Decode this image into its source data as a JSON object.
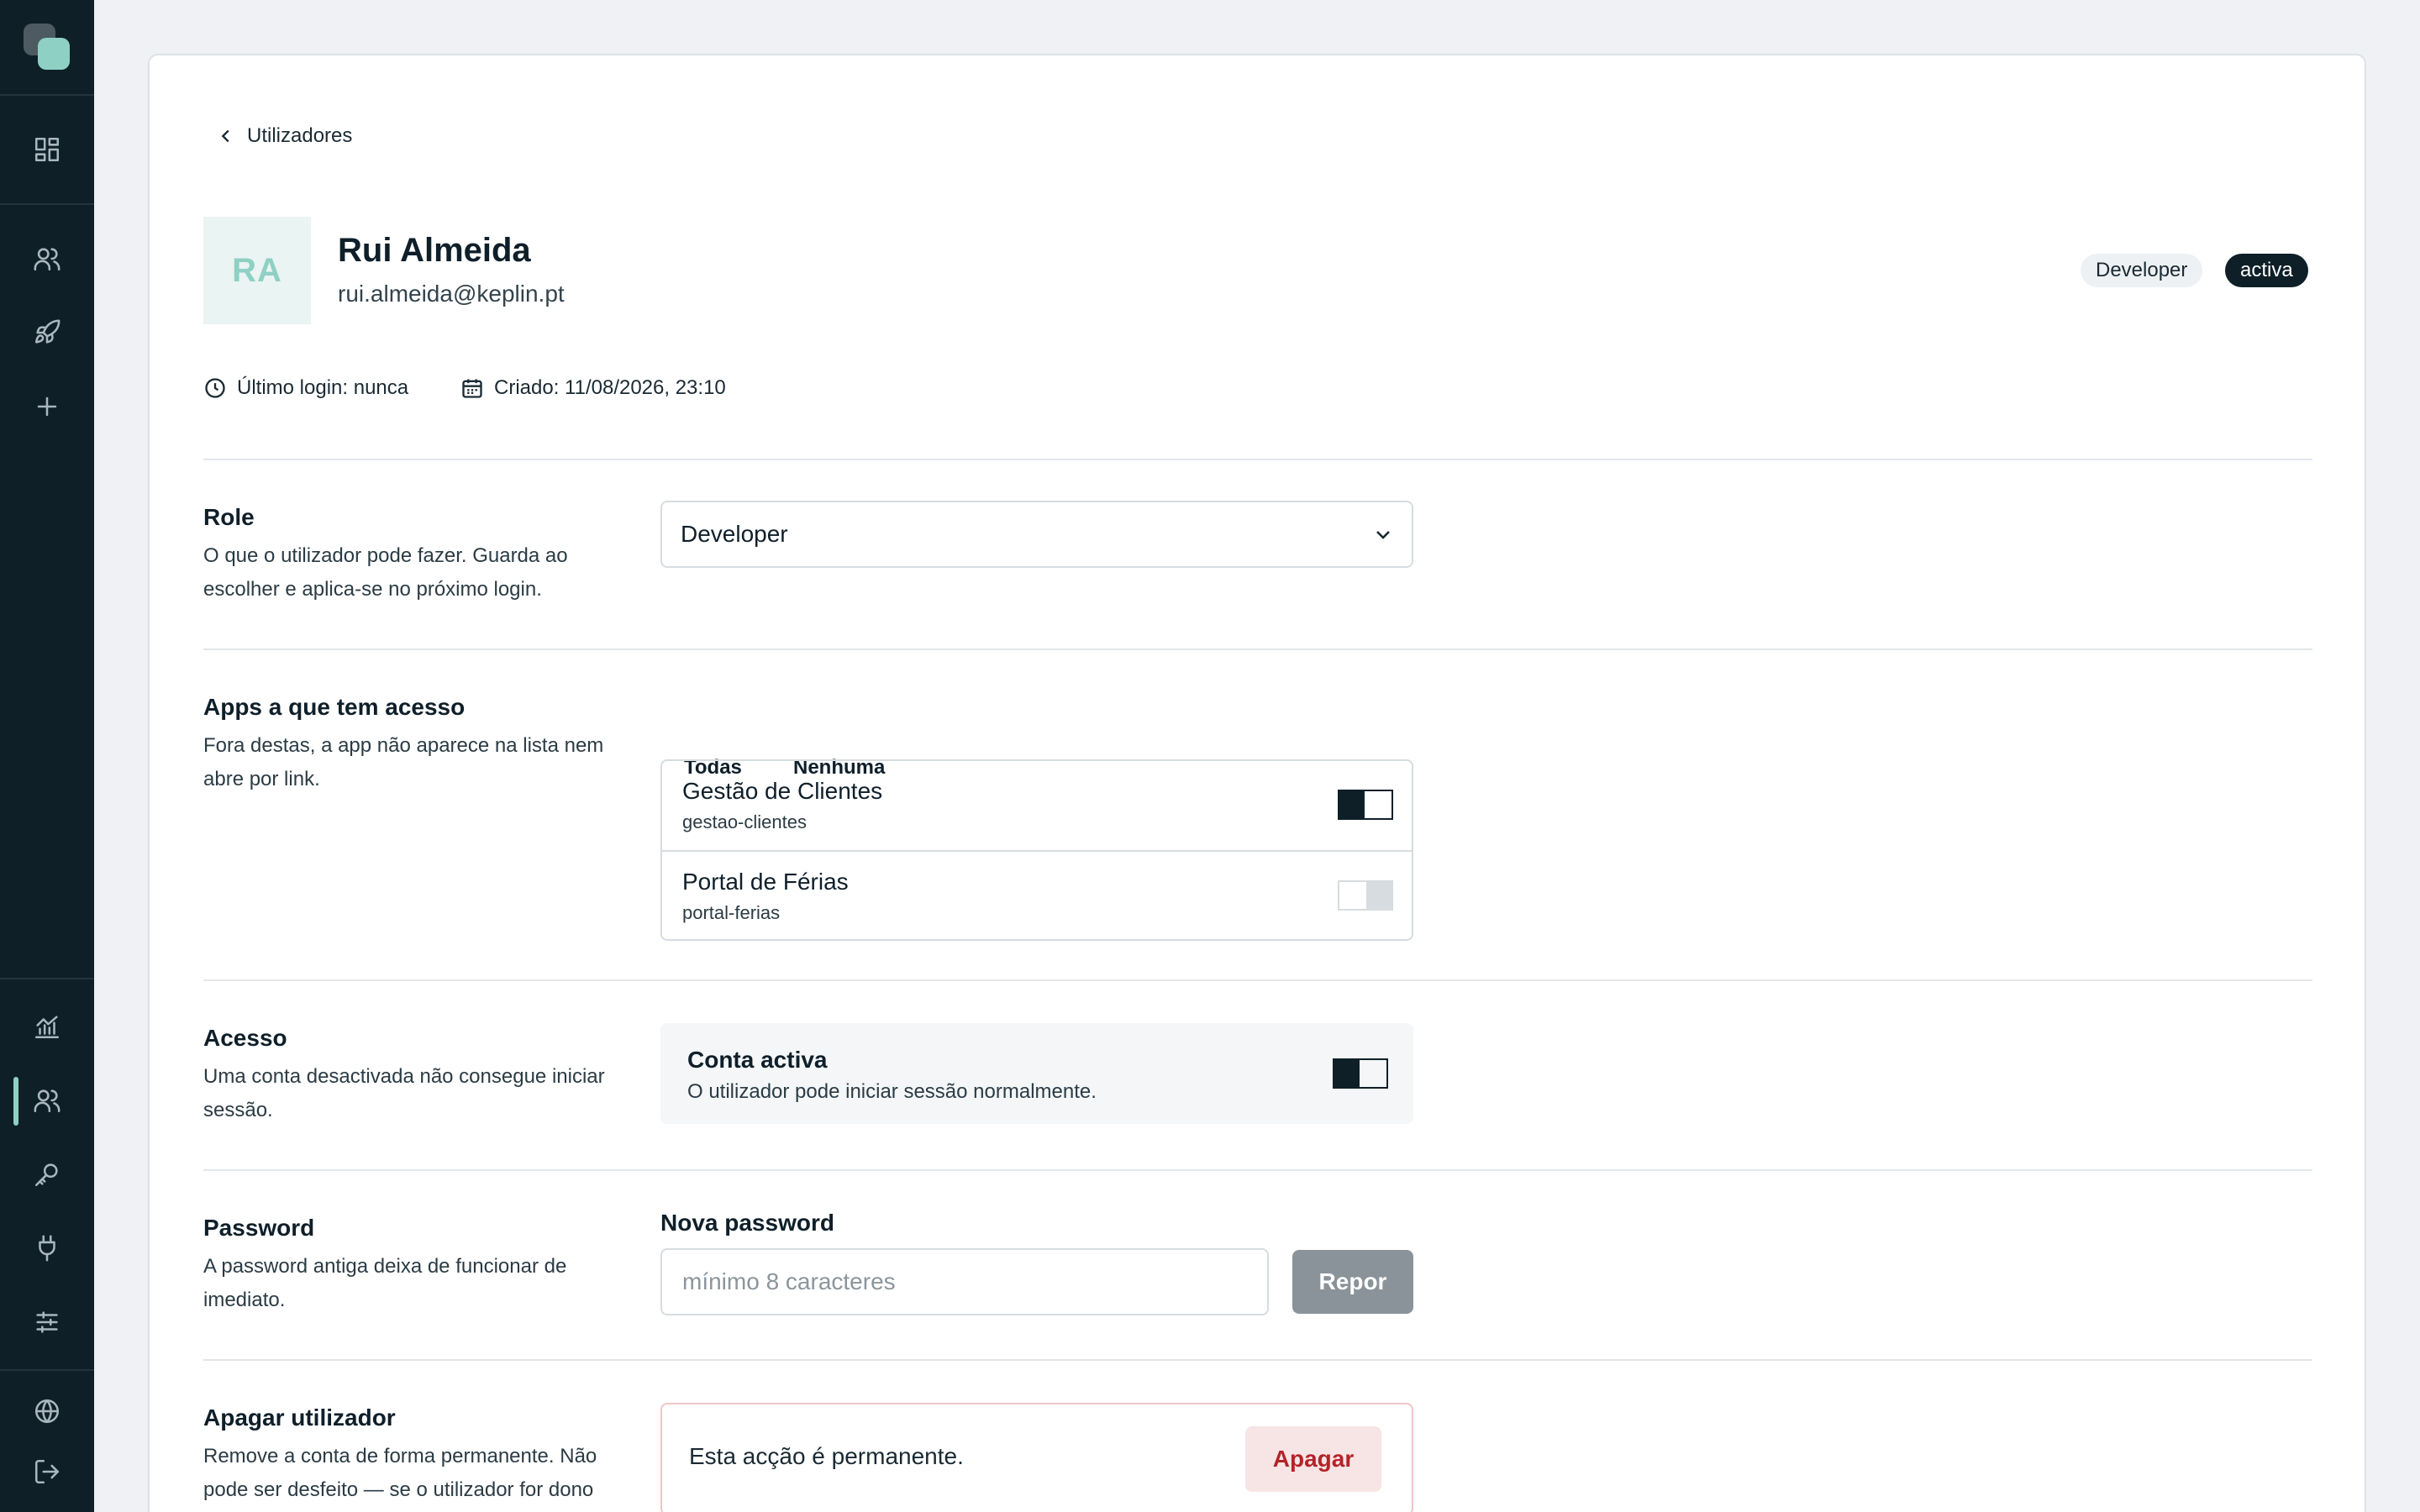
{
  "sidebar": {
    "items": [
      {
        "icon": "dashboard-icon"
      },
      {
        "icon": "users-icon"
      },
      {
        "icon": "rocket-icon"
      },
      {
        "icon": "plus-icon"
      },
      {
        "icon": "chart-icon"
      },
      {
        "icon": "users-icon",
        "active": true
      },
      {
        "icon": "key-icon"
      },
      {
        "icon": "plug-icon"
      },
      {
        "icon": "sliders-icon"
      },
      {
        "icon": "globe-icon"
      },
      {
        "icon": "logout-icon"
      }
    ],
    "accent_color": "#8fd0c4"
  },
  "breadcrumb": {
    "back_label": "Utilizadores"
  },
  "user": {
    "initials": "RA",
    "name": "Rui Almeida",
    "email": "rui.almeida@keplin.pt",
    "role_badge": "Developer",
    "status_badge": "activa",
    "last_login": "Último login: nunca",
    "created": "Criado: 11/08/2026, 23:10"
  },
  "role_section": {
    "title": "Role",
    "description": "O que o utilizador pode fazer. Guarda ao escolher e aplica-se no próximo login.",
    "selected": "Developer"
  },
  "apps_section": {
    "title": "Apps a que tem acesso",
    "description": "Fora destas, a app não aparece na lista nem abre por link.",
    "all_label": "Todas",
    "none_label": "Nenhuma",
    "apps": [
      {
        "name": "Gestão de Clientes",
        "slug": "gestao-clientes",
        "enabled": true
      },
      {
        "name": "Portal de Férias",
        "slug": "portal-ferias",
        "enabled": false
      }
    ]
  },
  "access_section": {
    "title": "Acesso",
    "description": "Uma conta desactivada não consegue iniciar sessão.",
    "toggle_title": "Conta activa",
    "toggle_desc": "O utilizador pode iniciar sessão normalmente.",
    "enabled": true
  },
  "password_section": {
    "title": "Password",
    "description": "A password antiga deixa de funcionar de imediato.",
    "field_label": "Nova password",
    "placeholder": "mínimo 8 caracteres",
    "button_label": "Repor"
  },
  "delete_section": {
    "title": "Apagar utilizador",
    "description": "Remove a conta de forma permanente. Não pode ser desfeito — se o utilizador for dono",
    "warning": "Esta acção é permanente.",
    "button_label": "Apagar",
    "danger_color": "#b4232a"
  }
}
